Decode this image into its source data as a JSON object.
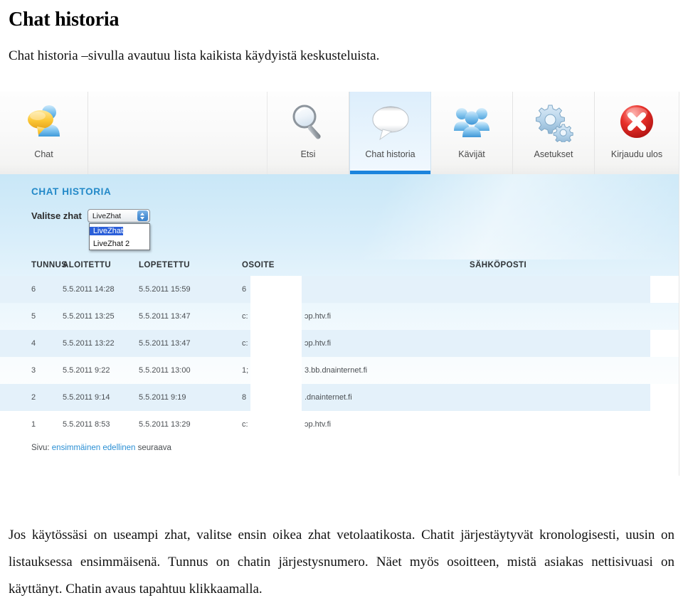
{
  "document": {
    "title": "Chat historia",
    "intro": "Chat historia –sivulla avautuu lista kaikista käydyistä keskusteluista.",
    "body": "Jos käytössäsi on useampi zhat, valitse ensin oikea zhat vetolaatikosta. Chatit järjestäytyvät kronologisesti, uusin on listauksessa ensimmäisenä. Tunnus on chatin järjestysnumero. Näet myös osoitteen, mistä asiakas nettisivuasi on käyttänyt. Chatin avaus tapahtuu klikkaamalla."
  },
  "app": {
    "toolbar": {
      "items": [
        {
          "label": "Chat",
          "icon": "chat-people-bubble-icon",
          "active": false
        },
        {
          "label": "",
          "icon": "",
          "active": false
        },
        {
          "label": "Etsi",
          "icon": "magnifier-icon",
          "active": false
        },
        {
          "label": "Chat historia",
          "icon": "speech-bubble-icon",
          "active": true
        },
        {
          "label": "Kävijät",
          "icon": "group-people-icon",
          "active": false
        },
        {
          "label": "Asetukset",
          "icon": "gears-icon",
          "active": false
        },
        {
          "label": "Kirjaudu ulos",
          "icon": "red-x-circle-icon",
          "active": false
        }
      ]
    },
    "panel": {
      "heading": "CHAT HISTORIA",
      "select": {
        "label": "Valitse zhat",
        "value": "LiveZhat",
        "options": [
          "LiveZhat",
          "LiveZhat 2"
        ],
        "selected_index": 0,
        "expanded": true
      },
      "table": {
        "columns": [
          "TUNNUS",
          "ALOITETTU",
          "LOPETETTU",
          "OSOITE",
          "SÄHKÖPOSTI"
        ],
        "rows": [
          {
            "tunnus": "6",
            "aloitettu": "5.5.2011 14:28",
            "lopetettu": "5.5.2011 15:59",
            "osoite_pre": "6",
            "osoite_post": "",
            "sahkoposti": "",
            "alt": true
          },
          {
            "tunnus": "5",
            "aloitettu": "5.5.2011 13:25",
            "lopetettu": "5.5.2011 13:47",
            "osoite_pre": "c:",
            "osoite_post": "ɔp.htv.fi",
            "sahkoposti": "",
            "alt": false
          },
          {
            "tunnus": "4",
            "aloitettu": "5.5.2011 13:22",
            "lopetettu": "5.5.2011 13:47",
            "osoite_pre": "c:",
            "osoite_post": "ɔp.htv.fi",
            "sahkoposti": "",
            "alt": true
          },
          {
            "tunnus": "3",
            "aloitettu": "5.5.2011 9:22",
            "lopetettu": "5.5.2011 13:00",
            "osoite_pre": "1;",
            "osoite_post": "3.bb.dnainternet.fi",
            "sahkoposti": "",
            "alt": false
          },
          {
            "tunnus": "2",
            "aloitettu": "5.5.2011 9:14",
            "lopetettu": "5.5.2011 9:19",
            "osoite_pre": "8",
            "osoite_post": ".dnainternet.fi",
            "sahkoposti": "",
            "alt": true
          },
          {
            "tunnus": "1",
            "aloitettu": "5.5.2011 8:53",
            "lopetettu": "5.5.2011 13:29",
            "osoite_pre": "c:",
            "osoite_post": "ɔp.htv.fi",
            "sahkoposti": "",
            "alt": false
          }
        ]
      },
      "pager": {
        "prefix": "Sivu:",
        "first": "ensimmäinen",
        "previous": "edellinen",
        "next": "seuraava"
      }
    },
    "colors": {
      "accent_blue": "#1b84dd",
      "heading_blue": "#2389c8",
      "link_blue": "#2b8fd4",
      "row_alt": "#e4f1fa",
      "select_highlight": "#2b5fd9"
    }
  }
}
